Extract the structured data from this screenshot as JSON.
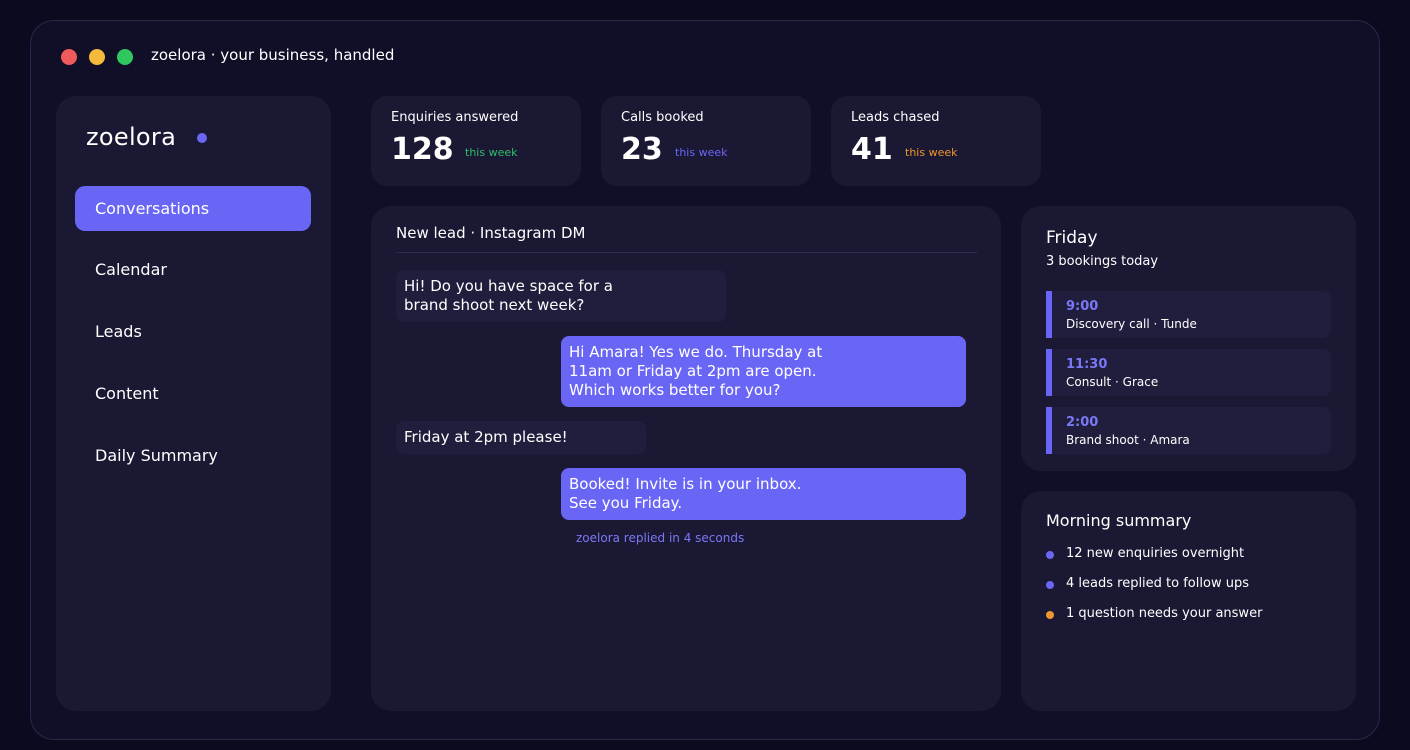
{
  "window": {
    "title": "zoelora  ·  your business, handled"
  },
  "sidebar": {
    "brand": "zoelora",
    "items": [
      {
        "label": "Conversations",
        "active": true
      },
      {
        "label": "Calendar",
        "active": false
      },
      {
        "label": "Leads",
        "active": false
      },
      {
        "label": "Content",
        "active": false
      },
      {
        "label": "Daily Summary",
        "active": false
      }
    ]
  },
  "stats": [
    {
      "label": "Enquiries answered",
      "value": "128",
      "note": "this week",
      "color": "#2fbf6b"
    },
    {
      "label": "Calls booked",
      "value": "23",
      "note": "this week",
      "color": "#6b67f5"
    },
    {
      "label": "Leads chased",
      "value": "41",
      "note": "this week",
      "color": "#f0962e"
    }
  ],
  "chat": {
    "header": "New lead  ·  Instagram DM",
    "messages": [
      {
        "from": "lead",
        "text": "Hi! Do you have space for a\nbrand shoot next week?"
      },
      {
        "from": "zoelora",
        "text": "Hi Amara! Yes we do. Thursday at\n11am or Friday at 2pm are open.\nWhich works better for you?"
      },
      {
        "from": "lead",
        "text": "Friday at 2pm please!"
      },
      {
        "from": "zoelora",
        "text": "Booked! Invite is in your inbox.\nSee you Friday."
      }
    ],
    "reply_note": "zoelora replied in 4 seconds"
  },
  "schedule": {
    "day": "Friday",
    "count": "3 bookings today",
    "bookings": [
      {
        "time": "9:00",
        "desc": "Discovery call · Tunde"
      },
      {
        "time": "11:30",
        "desc": "Consult · Grace"
      },
      {
        "time": "2:00",
        "desc": "Brand shoot · Amara"
      }
    ]
  },
  "summary": {
    "title": "Morning summary",
    "items": [
      {
        "text": "12 new enquiries overnight",
        "color": "#6b67f5"
      },
      {
        "text": "4 leads replied to follow ups",
        "color": "#6b67f5"
      },
      {
        "text": "1 question needs your answer",
        "color": "#f0962e"
      }
    ]
  },
  "colors": {
    "accent": "#6a66f5",
    "background": "#0b0a1f",
    "panel": "#1a1833"
  }
}
